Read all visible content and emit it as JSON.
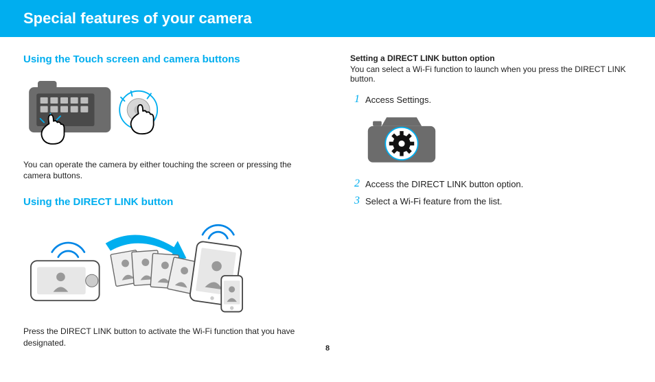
{
  "header": {
    "title": "Special features of your camera"
  },
  "left": {
    "section1_heading": "Using the Touch screen and camera buttons",
    "section1_body": "You can operate the camera by either touching the screen or pressing the camera buttons.",
    "section2_heading": "Using the DIRECT LINK button",
    "section2_body": "Press the DIRECT LINK button to activate the Wi-Fi function that you have designated."
  },
  "right": {
    "subheading": "Setting a DIRECT LINK button option",
    "subtext": "You can select a Wi-Fi function to launch when you press the DIRECT LINK button.",
    "steps": [
      {
        "num": "1",
        "text": "Access Settings."
      },
      {
        "num": "2",
        "text": "Access the DIRECT LINK button option."
      },
      {
        "num": "3",
        "text": "Select a Wi-Fi feature from the list."
      }
    ]
  },
  "page_number": "8",
  "icons": {
    "camera_touch": "camera-touch-illustration",
    "direct_link_share": "direct-link-share-illustration",
    "camera_settings": "camera-settings-gear-illustration"
  }
}
